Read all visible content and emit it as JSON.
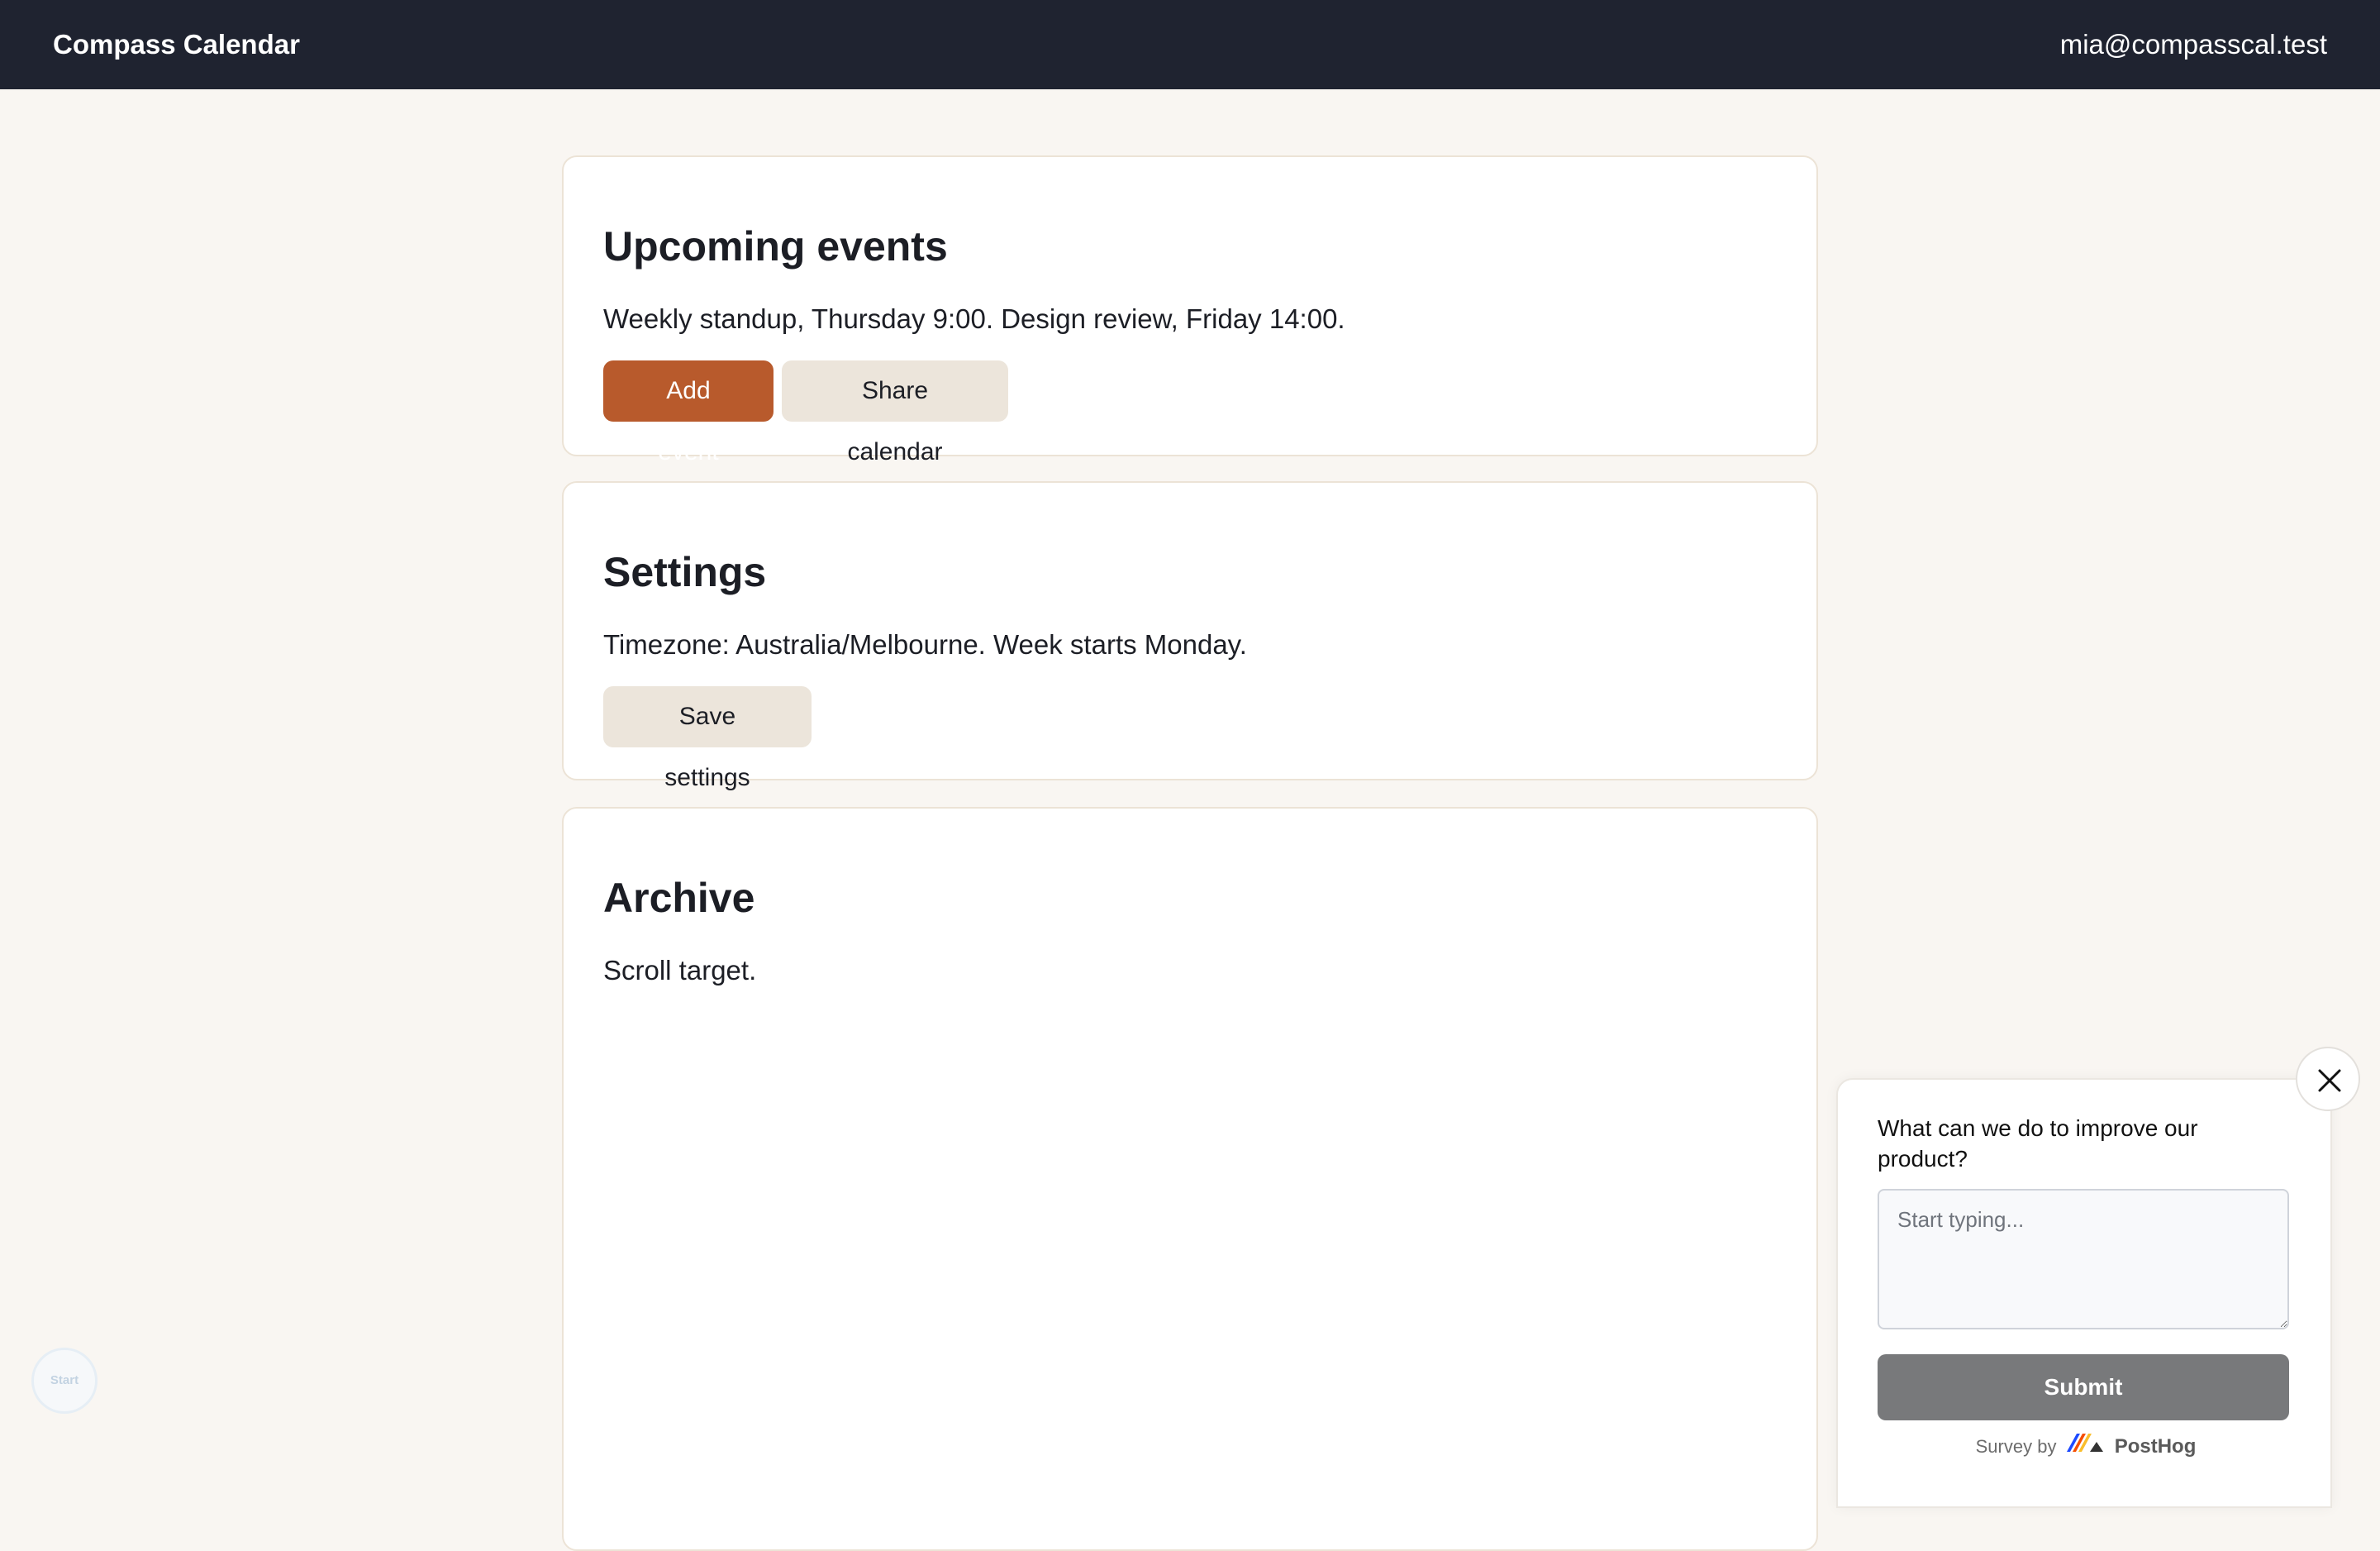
{
  "header": {
    "app_name": "Compass Calendar",
    "user_email": "mia@compasscal.test"
  },
  "upcoming": {
    "title": "Upcoming events",
    "summary": "Weekly standup, Thursday 9:00. Design review, Friday 14:00.",
    "add_event_label": "Add event",
    "share_calendar_label": "Share calendar"
  },
  "settings": {
    "title": "Settings",
    "summary": "Timezone: Australia/Melbourne. Week starts Monday.",
    "save_label": "Save settings"
  },
  "archive": {
    "title": "Archive",
    "summary": "Scroll target."
  },
  "survey": {
    "question": "What can we do to improve our product?",
    "placeholder": "Start typing...",
    "submit_label": "Submit",
    "footer_prefix": "Survey by",
    "footer_brand": "PostHog",
    "close_icon": "close-icon",
    "logo_icon": "posthog-logo-icon"
  },
  "start_badge": {
    "label": "Start"
  },
  "colors": {
    "topbar": "#1f2330",
    "primary": "#b85a2c",
    "secondary": "#ece5db",
    "page_bg": "#f9f6f2",
    "submit": "#78797b"
  }
}
